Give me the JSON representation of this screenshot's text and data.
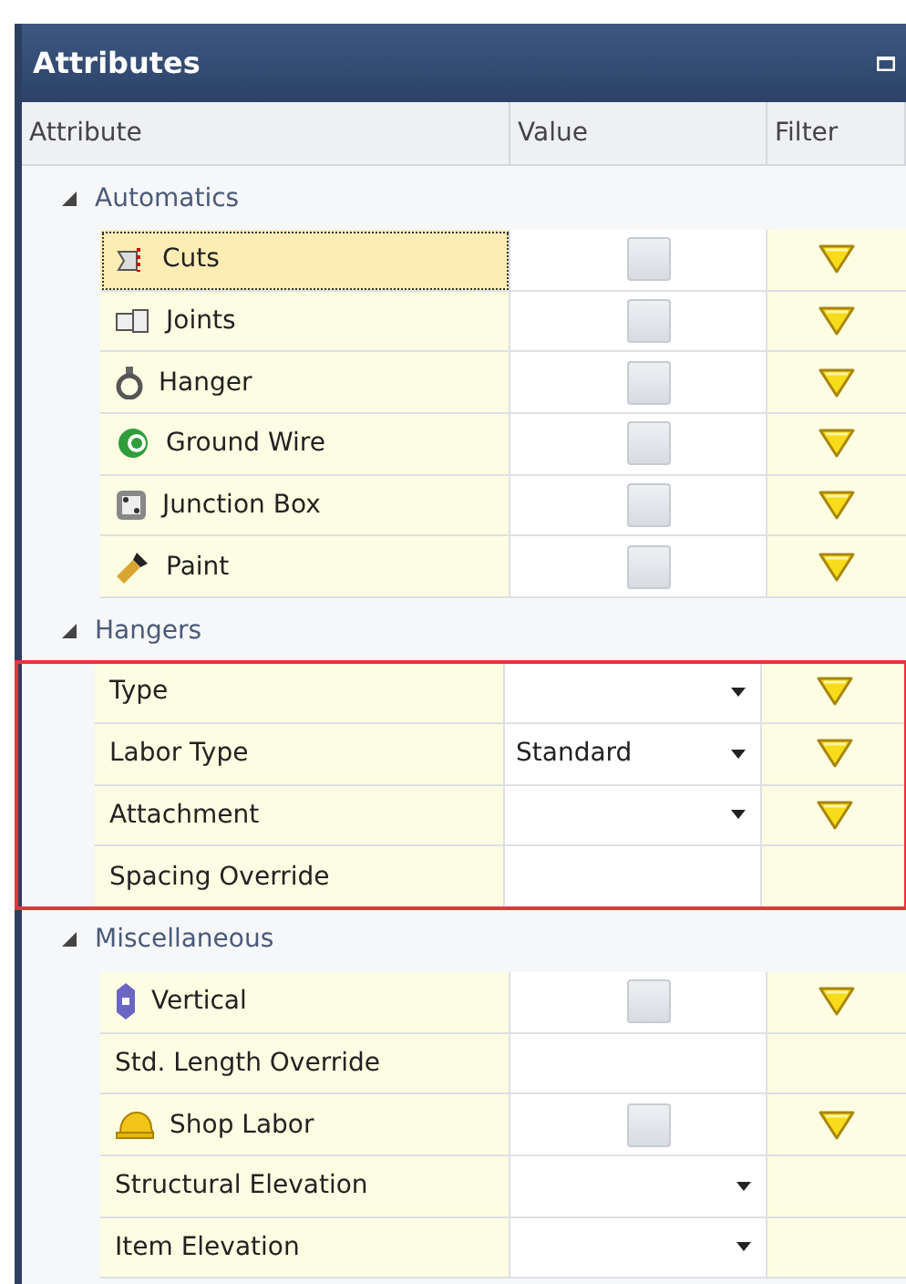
{
  "panel": {
    "title": "Attributes"
  },
  "columns": [
    "Attribute",
    "Value",
    "Filter"
  ],
  "groups": [
    {
      "label": "Automatics",
      "expanded": true,
      "highlighted": false,
      "items": [
        {
          "label": "Cuts",
          "kind": "checkbox",
          "checked": false,
          "filter": true,
          "selected": true
        },
        {
          "label": "Joints",
          "kind": "checkbox",
          "checked": false,
          "filter": true,
          "selected": false
        },
        {
          "label": "Hanger",
          "kind": "checkbox",
          "checked": false,
          "filter": true,
          "selected": false
        },
        {
          "label": "Ground Wire",
          "kind": "checkbox",
          "checked": false,
          "filter": true,
          "selected": false
        },
        {
          "label": "Junction Box",
          "kind": "checkbox",
          "checked": false,
          "filter": true,
          "selected": false
        },
        {
          "label": "Paint",
          "kind": "checkbox",
          "checked": false,
          "filter": true,
          "selected": false
        }
      ]
    },
    {
      "label": "Hangers",
      "expanded": true,
      "highlighted": true,
      "items": [
        {
          "label": "Type",
          "kind": "dropdown",
          "filter": true,
          "selected": false
        },
        {
          "label": "Labor Type",
          "kind": "dropdown",
          "value": "Standard",
          "filter": true,
          "selected": false
        },
        {
          "label": "Attachment",
          "kind": "dropdown",
          "filter": true,
          "selected": false
        },
        {
          "label": "Spacing Override",
          "kind": "text",
          "filter": false,
          "selected": false
        }
      ]
    },
    {
      "label": "Miscellaneous",
      "expanded": true,
      "highlighted": false,
      "items": [
        {
          "label": "Vertical",
          "kind": "checkbox",
          "checked": false,
          "filter": true,
          "selected": false
        },
        {
          "label": "Std. Length Override",
          "kind": "text",
          "filter": false,
          "selected": false
        },
        {
          "label": "Shop Labor",
          "kind": "checkbox",
          "checked": false,
          "filter": true,
          "selected": false
        },
        {
          "label": "Structural Elevation",
          "kind": "dropdown",
          "filter": false,
          "selected": false
        },
        {
          "label": "Item Elevation",
          "kind": "dropdown",
          "filter": false,
          "selected": false
        }
      ]
    }
  ]
}
